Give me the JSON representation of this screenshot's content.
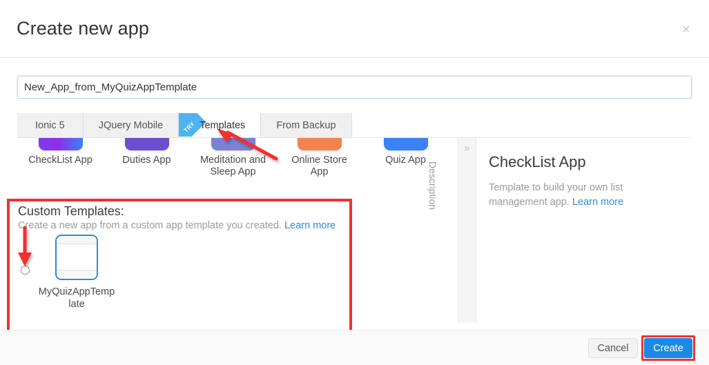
{
  "dialog": {
    "title": "Create new app",
    "close_label": "×"
  },
  "name_field": {
    "value": "New_App_from_MyQuizAppTemplate",
    "placeholder": "App name"
  },
  "tabs": [
    {
      "label": "Ionic 5",
      "active": false,
      "ribbon": ""
    },
    {
      "label": "JQuery Mobile",
      "active": false,
      "ribbon": ""
    },
    {
      "label": "Templates",
      "active": true,
      "ribbon": "TRY"
    },
    {
      "label": "From Backup",
      "active": false,
      "ribbon": ""
    }
  ],
  "templates": [
    {
      "name": "CheckList App",
      "color": "linear-gradient(90deg,#7b3dee 0%,#8b2fe8 45%,#3b82f6 100%)"
    },
    {
      "name": "Duties App",
      "color": "#6a4fd0"
    },
    {
      "name": "Meditation and Sleep App",
      "color": "#7b82d4"
    },
    {
      "name": "Online Store App",
      "color": "#f5834f"
    },
    {
      "name": "Quiz App",
      "color": "#3b82f6"
    }
  ],
  "custom_templates": {
    "title": "Custom Templates:",
    "subtitle": "Create a new app from a custom app template you created.",
    "learn_more": "Learn more",
    "item_label": "MyQuizAppTemplate",
    "selected": false
  },
  "description": {
    "strip_label": "Description",
    "chevron": "»",
    "title": "CheckList App",
    "body": "Template to build your own list management app.",
    "learn_more": "Learn more"
  },
  "footer": {
    "cancel_label": "Cancel",
    "create_label": "Create"
  },
  "colors": {
    "accent_blue": "#1a8ae5",
    "link_blue": "#2a8ae0",
    "annotation_red": "#f52f2f",
    "ribbon_blue": "#4fb3ef"
  }
}
